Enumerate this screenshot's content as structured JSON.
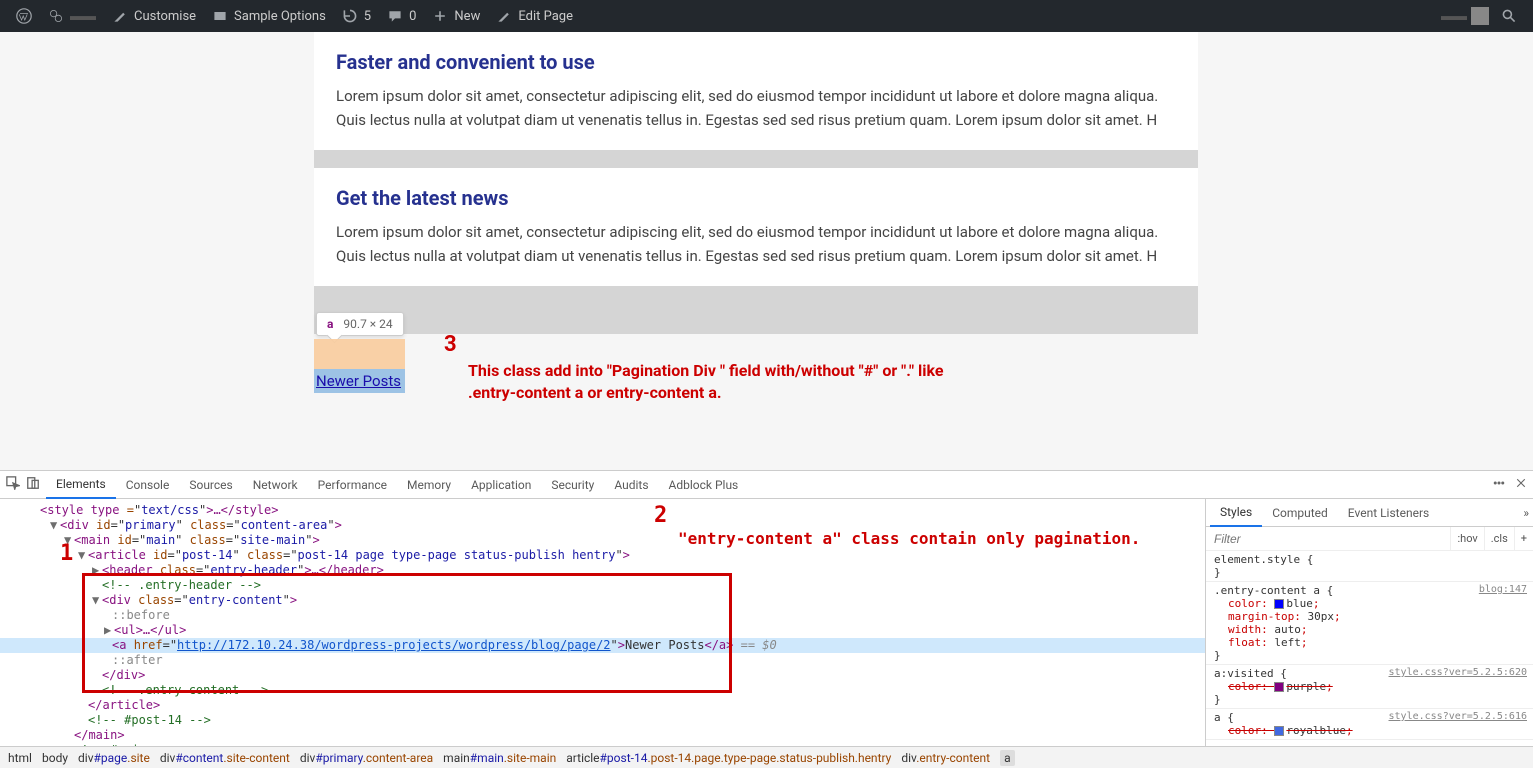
{
  "admin_bar": {
    "customise": "Customise",
    "sample_options": "Sample Options",
    "updates": "5",
    "comments": "0",
    "new": "New",
    "edit_page": "Edit Page"
  },
  "content": {
    "card1": {
      "title": "Faster and convenient to use",
      "body": "Lorem ipsum dolor sit amet, consectetur adipiscing elit, sed do eiusmod tempor incididunt ut labore et dolore magna aliqua. Quis lectus nulla at volutpat diam ut venenatis tellus in. Egestas sed sed risus pretium quam. Lorem ipsum dolor sit amet. H"
    },
    "card2": {
      "title": "Get the latest news",
      "body": "Lorem ipsum dolor sit amet, consectetur adipiscing elit, sed do eiusmod tempor incididunt ut labore et dolore magna aliqua. Quis lectus nulla at volutpat diam ut venenatis tellus in. Egestas sed sed risus pretium quam. Lorem ipsum dolor sit amet. H"
    },
    "newer_posts": "Newer Posts"
  },
  "inspect": {
    "tag": "a",
    "dim": "90.7 × 24"
  },
  "annotations": {
    "n1": "1",
    "n2": "2",
    "n3": "3",
    "text3": "This class add into \"Pagination Div \" field with/without \"#\" or \".\" like .entry-content a or entry-content a.",
    "text2": "\"entry-content a\" class contain only pagination."
  },
  "devtools": {
    "tabs": [
      "Elements",
      "Console",
      "Sources",
      "Network",
      "Performance",
      "Memory",
      "Application",
      "Security",
      "Audits",
      "Adblock Plus"
    ],
    "lines": {
      "style_fragment_open": "style type",
      "style_fragment_val": "text/css",
      "style_fragment_close": "style",
      "primary_id": "primary",
      "primary_class": "content-area",
      "main_id": "main",
      "main_class": "site-main",
      "article_id": "post-14",
      "article_class": "post-14 page type-page status-publish hentry",
      "header_class": "entry-header",
      "header_close": "header",
      "entry_header_comment": "<!-- .entry-header -->",
      "entry_class": "entry-content",
      "before": "::before",
      "ul_open": "ul",
      "ul_close": "/ul",
      "a_href": "http://172.10.24.38/wordpress-projects/wordpress/blog/page/2",
      "a_text": "Newer Posts",
      "eq0": "== $0",
      "after": "::after",
      "div_close": "/div",
      "entry_comment": "<!-- .entry-content -->",
      "article_close": "/article",
      "post14_comment": "<!-- #post-14 -->",
      "main_close": "/main",
      "main_comment": "<!-- #main -->"
    },
    "styles_tabs": [
      "Styles",
      "Computed",
      "Event Listeners"
    ],
    "filter_placeholder": "Filter",
    "hov": ":hov",
    "cls": ".cls",
    "rules": {
      "elstyle": "element.style {",
      "r1sel": ".entry-content a {",
      "r1src": "blog:147",
      "r1p1": "color",
      "r1v1": "blue",
      "r1c1": "#0000ff",
      "r1p2": "margin-top",
      "r1v2": "30px",
      "r1p3": "width",
      "r1v3": "auto",
      "r1p4": "float",
      "r1v4": "left",
      "r2sel": "a:visited {",
      "r2src": "style.css?ver=5.2.5:620",
      "r2p1": "color",
      "r2v1": "purple",
      "r2c1": "#800080",
      "r3sel": "a {",
      "r3src": "style.css?ver=5.2.5:616",
      "r3p1": "color",
      "r3v1": "royalblue",
      "r3c1": "#4169e1"
    }
  },
  "breadcrumb": [
    "html",
    "body",
    "div#page.site",
    "div#content.site-content",
    "div#primary.content-area",
    "main#main.site-main",
    "article#post-14.post-14.page.type-page.status-publish.hentry",
    "div.entry-content",
    "a"
  ]
}
